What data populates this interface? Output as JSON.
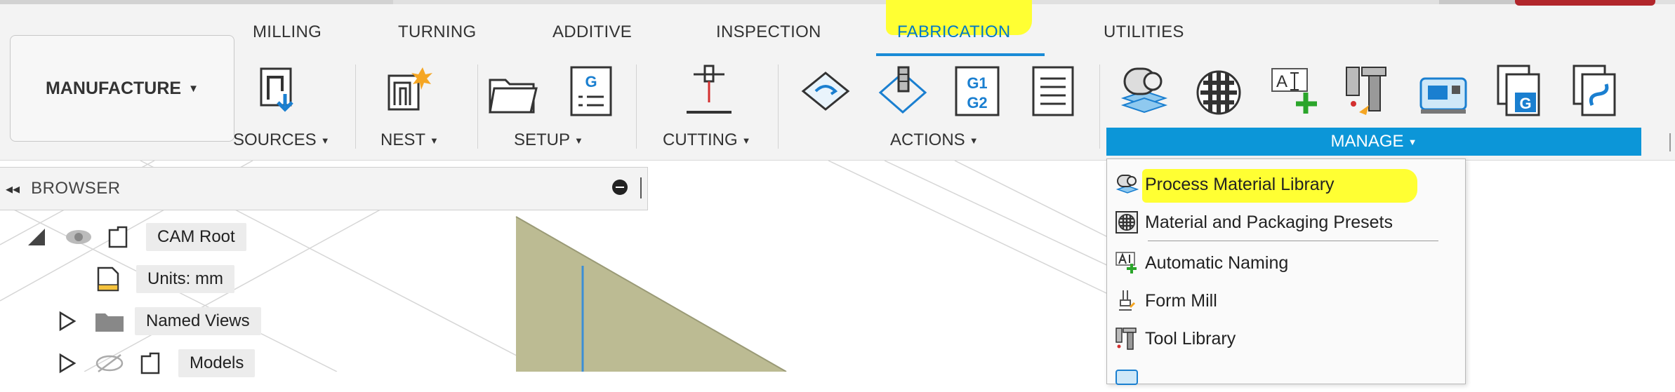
{
  "tabs": [
    {
      "label": "MILLING"
    },
    {
      "label": "TURNING"
    },
    {
      "label": "ADDITIVE"
    },
    {
      "label": "INSPECTION"
    },
    {
      "label": "FABRICATION"
    },
    {
      "label": "UTILITIES"
    }
  ],
  "active_tab": "FABRICATION",
  "workspace": {
    "label": "MANUFACTURE"
  },
  "groups": {
    "sources": "SOURCES",
    "nest": "NEST",
    "setup": "SETUP",
    "cutting": "CUTTING",
    "actions": "ACTIONS",
    "manage": "MANAGE"
  },
  "icons": {
    "setup_g": "G",
    "g1g2_top": "G1",
    "g1g2_bottom": "G2",
    "auto_naming": "A",
    "nc_program_g": "G"
  },
  "browser": {
    "title": "BROWSER",
    "items": [
      {
        "label": "CAM Root"
      },
      {
        "label": "Units: mm"
      },
      {
        "label": "Named Views"
      },
      {
        "label": "Models"
      }
    ]
  },
  "manage_menu": {
    "items": [
      {
        "label": "Process Material Library",
        "icon": "process-material-icon"
      },
      {
        "label": "Material and Packaging Presets",
        "icon": "material-presets-icon"
      },
      {
        "label": "Automatic Naming",
        "icon": "automatic-naming-icon"
      },
      {
        "label": "Form Mill",
        "icon": "form-mill-icon"
      },
      {
        "label": "Tool Library",
        "icon": "tool-library-icon"
      }
    ]
  },
  "colors": {
    "accent": "#0c96d8",
    "highlight": "#ffff33",
    "brand_red": "#b1262b"
  }
}
